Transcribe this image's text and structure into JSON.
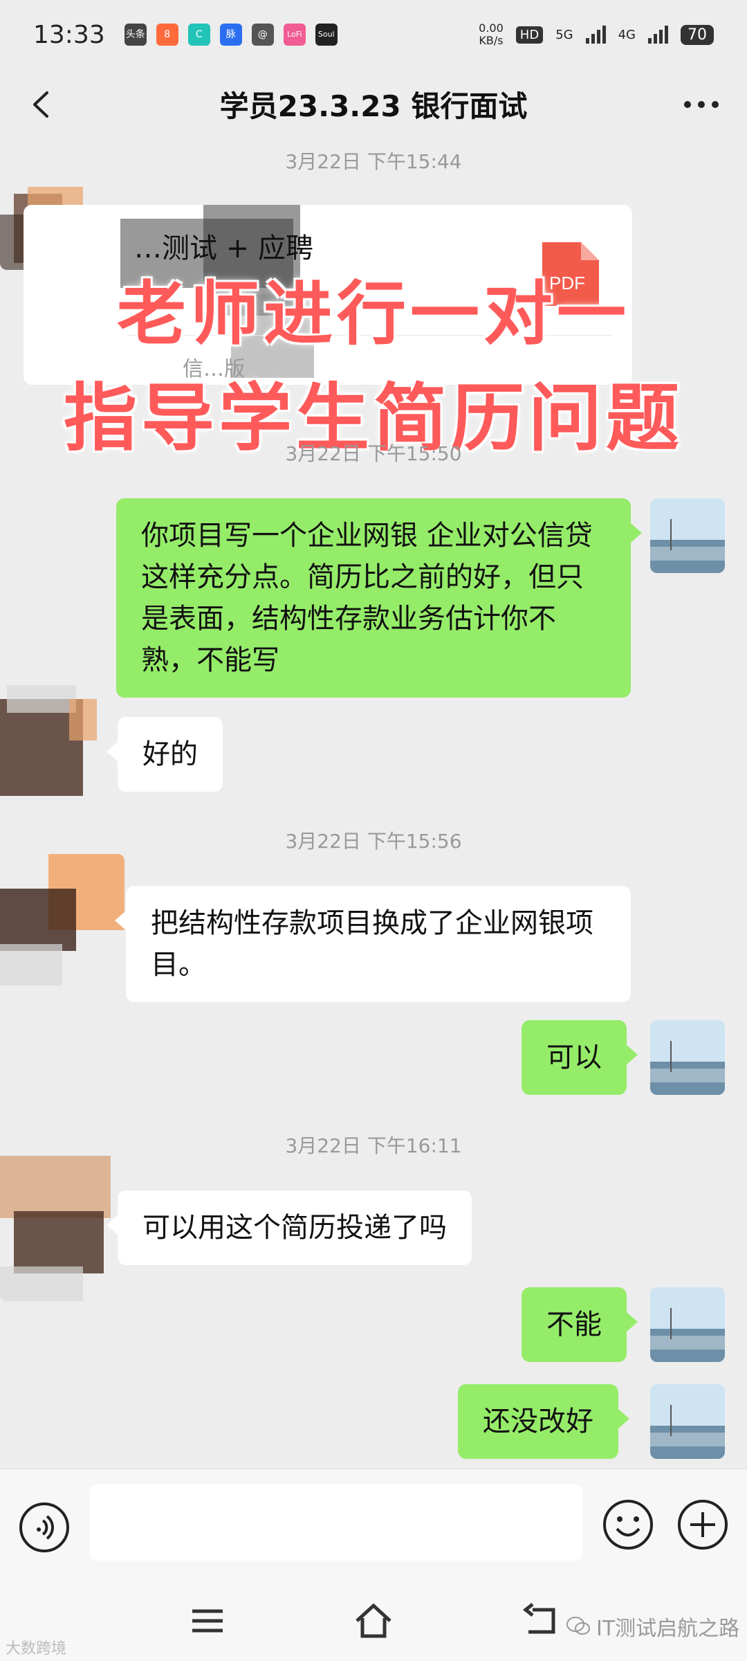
{
  "status_bar": {
    "time": "13:33",
    "app_icons": [
      {
        "label": "头条",
        "color": "#444444"
      },
      {
        "label": "8",
        "color": "#ff6a3d"
      },
      {
        "label": "C",
        "color": "#22c4b8"
      },
      {
        "label": "脉",
        "color": "#2b6ff0"
      },
      {
        "label": "@",
        "color": "#555555"
      },
      {
        "label": "LoFi",
        "color": "#f05c93"
      },
      {
        "label": "Soul",
        "color": "#222222"
      }
    ],
    "net_speed_value": "0.00",
    "net_speed_unit": "KB/s",
    "hd_label": "HD",
    "sim1_label": "5G",
    "sim2_label": "4G",
    "battery": "70"
  },
  "header": {
    "title": "学员23.3.23 银行面试",
    "back_icon": "chevron-left-icon",
    "more_icon": "more-dots-icon"
  },
  "chat": {
    "timestamps": [
      "3月22日 下午15:44",
      "3月22日 下午15:50",
      "3月22日 下午15:56",
      "3月22日 下午16:11"
    ],
    "file_card": {
      "file_name": "…测试 + 应聘",
      "file_type": "PDF",
      "sub_text": "信…版"
    },
    "overlay": {
      "line1": "老师进行一对一",
      "line2": "指导学生简历问题"
    },
    "messages": [
      {
        "side": "right",
        "text": "你项目写一个企业网银 企业对公信贷这样充分点。简历比之前的好，但只是表面，结构性存款业务估计你不熟，不能写"
      },
      {
        "side": "left",
        "text": "好的"
      },
      {
        "side": "left",
        "text": "把结构性存款项目换成了企业网银项目。"
      },
      {
        "side": "right",
        "text": "可以"
      },
      {
        "side": "left",
        "text": "可以用这个简历投递了吗"
      },
      {
        "side": "right",
        "text": "不能"
      },
      {
        "side": "right",
        "text": "还没改好"
      }
    ]
  },
  "input_bar": {
    "value": "",
    "voice_icon": "voice-icon",
    "emoji_icon": "emoji-icon",
    "plus_icon": "plus-icon"
  },
  "nav_bar": {
    "menu_icon": "menu-icon",
    "home_icon": "home-icon",
    "back_icon": "back-arrow-icon"
  },
  "watermarks": {
    "left": "大数跨境",
    "right": "IT测试启航之路"
  },
  "colors": {
    "background": "#ededed",
    "sent_bubble": "#95ec69",
    "received_bubble": "#ffffff",
    "overlay_text": "#ff5a5a"
  }
}
